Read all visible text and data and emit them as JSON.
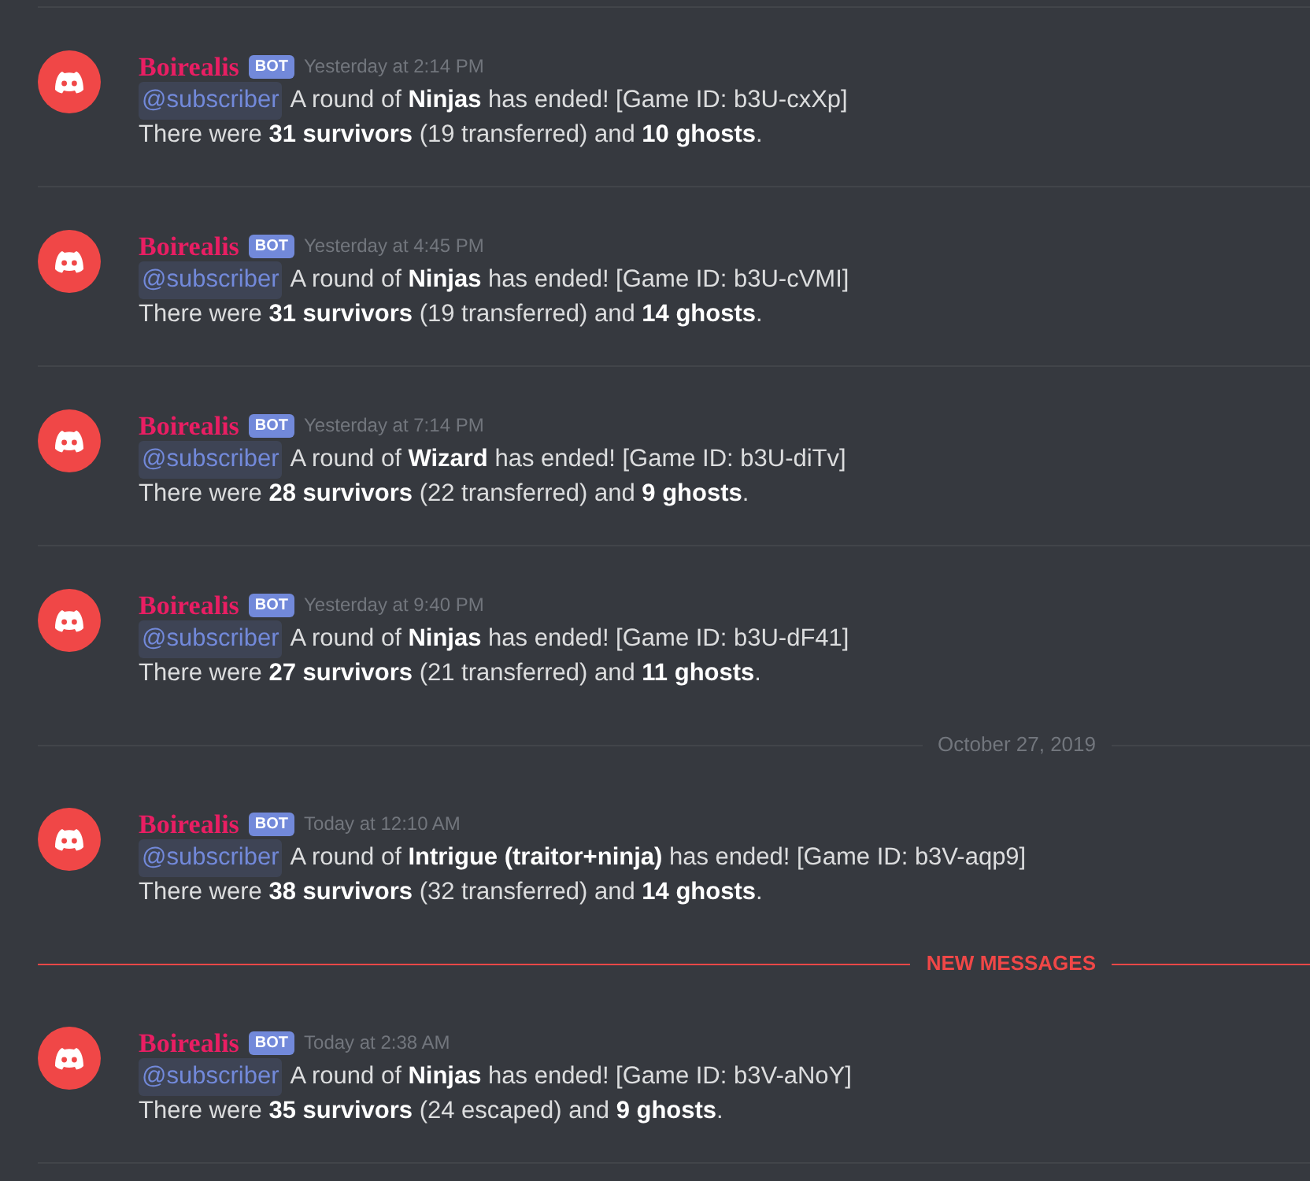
{
  "messages": [
    {
      "kind": "message",
      "author": "Boirealis",
      "tag": "BOT",
      "timestamp": "Yesterday at 2:14 PM",
      "mention": "@subscriber",
      "text": "A round of **Ninjas** has ended! [Game ID: b3U-cxXp]",
      "text_2": "There were **31 survivors** (19 transferred) and **10 ghosts**."
    },
    {
      "kind": "message",
      "author": "Boirealis",
      "tag": "BOT",
      "timestamp": "Yesterday at 4:45 PM",
      "mention": "@subscriber",
      "text": "A round of **Ninjas** has ended! [Game ID: b3U-cVMI]",
      "text_2": "There were **31 survivors** (19 transferred) and **14 ghosts**."
    },
    {
      "kind": "message",
      "author": "Boirealis",
      "tag": "BOT",
      "timestamp": "Yesterday at 7:14 PM",
      "mention": "@subscriber",
      "text": "A round of **Wizard** has ended! [Game ID: b3U-diTv]",
      "text_2": "There were **28 survivors** (22 transferred) and **9 ghosts**."
    },
    {
      "kind": "message",
      "author": "Boirealis",
      "tag": "BOT",
      "timestamp": "Yesterday at 9:40 PM",
      "mention": "@subscriber",
      "text": "A round of **Ninjas** has ended! [Game ID: b3U-dF41]",
      "text_2": "There were **27 survivors** (21 transferred) and **11 ghosts**."
    },
    {
      "kind": "date_divider",
      "label": "October 27, 2019"
    },
    {
      "kind": "message",
      "author": "Boirealis",
      "tag": "BOT",
      "timestamp": "Today at 12:10 AM",
      "mention": "@subscriber",
      "text": "A round of **Intrigue (traitor+ninja)** has ended! [Game ID: b3V-aqp9]",
      "text_2": "There were **38 survivors** (32 transferred) and **14 ghosts**."
    },
    {
      "kind": "new_divider",
      "label": "NEW MESSAGES"
    },
    {
      "kind": "message",
      "author": "Boirealis",
      "tag": "BOT",
      "timestamp": "Today at 2:38 AM",
      "mention": "@subscriber",
      "text": "A round of **Ninjas** has ended! [Game ID: b3V-aNoY]",
      "text_2": "There were **35 survivors** (24 escaped) and **9 ghosts**."
    }
  ]
}
